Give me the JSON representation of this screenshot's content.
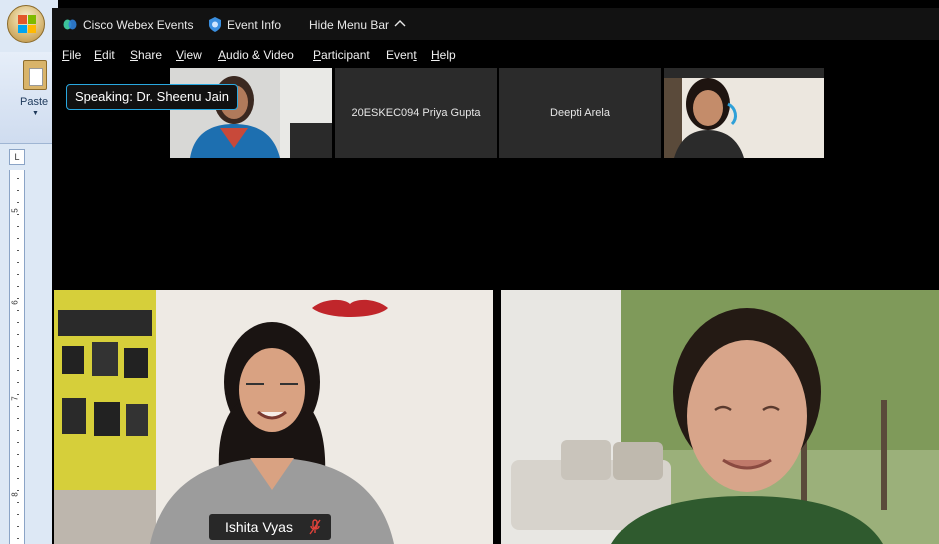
{
  "word": {
    "paste_label": "Paste",
    "ruler_corner": "L",
    "ruler_numbers": [
      "5",
      "6",
      "7",
      "8"
    ]
  },
  "webex": {
    "app_title": "Cisco Webex Events",
    "event_info": "Event Info",
    "hide_menu_bar": "Hide Menu Bar",
    "menu": [
      {
        "label": "File",
        "accel": "F"
      },
      {
        "label": "Edit",
        "accel": "E"
      },
      {
        "label": "Share",
        "accel": "S"
      },
      {
        "label": "View",
        "accel": "V"
      },
      {
        "label": "Audio & Video",
        "accel": "A"
      },
      {
        "label": "Participant",
        "accel": "P"
      },
      {
        "label": "Event",
        "accel": "t"
      },
      {
        "label": "Help",
        "accel": "H"
      }
    ],
    "speaking_label": "Speaking: Dr. Sheenu Jain",
    "thumbnails": [
      {
        "name": "20ESKEC094 Priya Gupta",
        "type": "text"
      },
      {
        "name": "Deepti Arela",
        "type": "text"
      }
    ],
    "main_tiles": [
      {
        "name": "Ishita Vyas",
        "muted": true,
        "mute_icon": "mic-muted-icon"
      },
      {
        "name": "",
        "muted": false
      }
    ],
    "colors": {
      "accent": "#29a8e0",
      "mute_red": "#e0423a",
      "tile_gray": "#2b2b2b"
    }
  }
}
